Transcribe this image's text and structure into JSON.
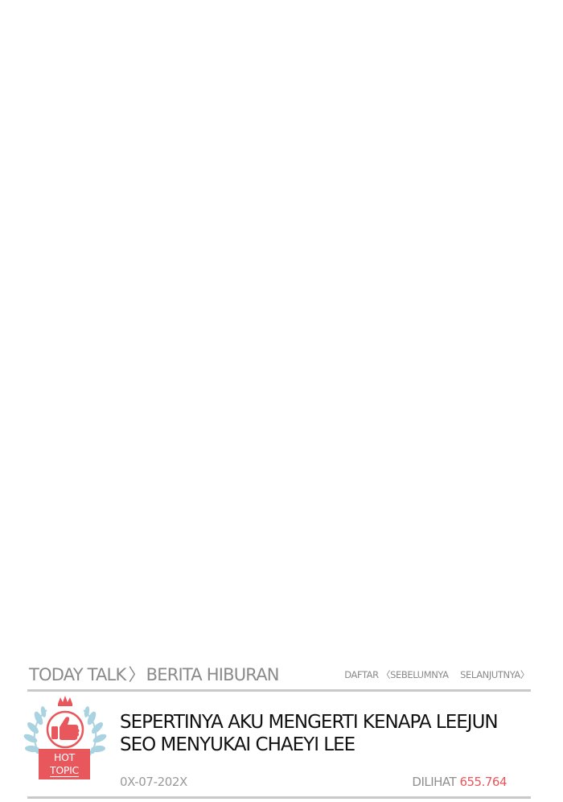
{
  "header": {
    "section": "TODAY TALK",
    "separator": "〉",
    "category": "BERITA HIBURAN",
    "nav": {
      "list": "DAFTAR",
      "prev": "〈SEBELUMNYA",
      "next": "SELANJUTNYA〉"
    }
  },
  "badge": {
    "line1": "HOT",
    "line2": "TOPIC",
    "icon": "thumbs-up-laurel-crown"
  },
  "post": {
    "title_line1": "SEPERTINYA AKU MENGERTI KENAPA LEEJUN",
    "title_line2": "SEO MENYUKAI CHAEYI LEE",
    "date": "0X-07-202X",
    "views_label": "DILIHAT",
    "views_count": "655.764"
  },
  "colors": {
    "accent": "#e8575c",
    "muted_text": "#8a8a8a",
    "rule": "#c9c9c9",
    "laurel": "#a9d3e0"
  }
}
